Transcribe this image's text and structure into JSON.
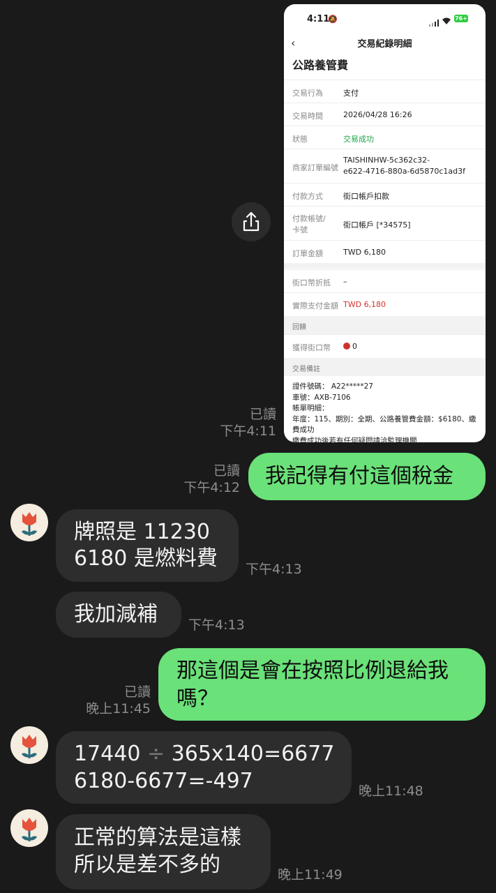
{
  "screenshot": {
    "status_time": "4:11",
    "battery": "76+",
    "header_title": "交易紀錄明細",
    "page_title": "公路養管費",
    "rows": [
      {
        "label": "交易行為",
        "value": "支付"
      },
      {
        "label": "交易時間",
        "value": "2026/04/28 16:26"
      },
      {
        "label": "狀態",
        "value": "交易成功"
      },
      {
        "label": "商家訂單編號",
        "value_line1": "TAISHINHW-5c362c32-",
        "value_line2": "e622-4716-880a-6d5870c1ad3f"
      },
      {
        "label": "付款方式",
        "value": "街口帳戶扣款"
      },
      {
        "label_line1": "付款帳號/",
        "label_line2": "卡號",
        "value": "街口帳戶 [*34575]"
      },
      {
        "label": "訂單金額",
        "value": "TWD 6,180"
      },
      {
        "label": "街口幣折抵",
        "value": "–"
      },
      {
        "label": "實際支付金額",
        "value": "TWD 6,180"
      }
    ],
    "section_return": "回饋",
    "reward_label": "獲得街口幣",
    "reward_value": "0",
    "section_note": "交易備註",
    "note_lines": [
      "證件號碼： A22*****27",
      "車號：AXB-7106",
      "帳單明細：",
      "年度：115、期別：全期、公路養管費金額：$6180、繳",
      "費成功",
      "繳費成功後若有任何疑問請洽監理機關"
    ],
    "success_color": "#1ea64a",
    "amount_color": "#d0312d"
  },
  "messages": [
    {
      "read": "已讀",
      "time": "下午4:11"
    },
    {
      "text": "我記得有付這個稅金",
      "read": "已讀",
      "time": "下午4:12"
    },
    {
      "line1": "牌照是 11230",
      "line2": "6180 是燃料費",
      "time": "下午4:13"
    },
    {
      "text": "我加減補",
      "time": "下午4:13"
    },
    {
      "line1": "那這個是會在按照比例退給我",
      "line2": "嗎？",
      "read": "已讀",
      "time": "晚上11:45"
    },
    {
      "line1a": "17440",
      "divide": "÷",
      "line1b": "365x140=6677",
      "line2": "6180-6677=-497",
      "time": "晚上11:48"
    },
    {
      "line1": "正常的算法是這樣",
      "line2": "所以是差不多的",
      "time": "晚上11:49"
    }
  ],
  "colors": {
    "green_bubble": "#6ae179",
    "gray_bubble": "#2d2d2d",
    "background": "#1a1a1a"
  }
}
